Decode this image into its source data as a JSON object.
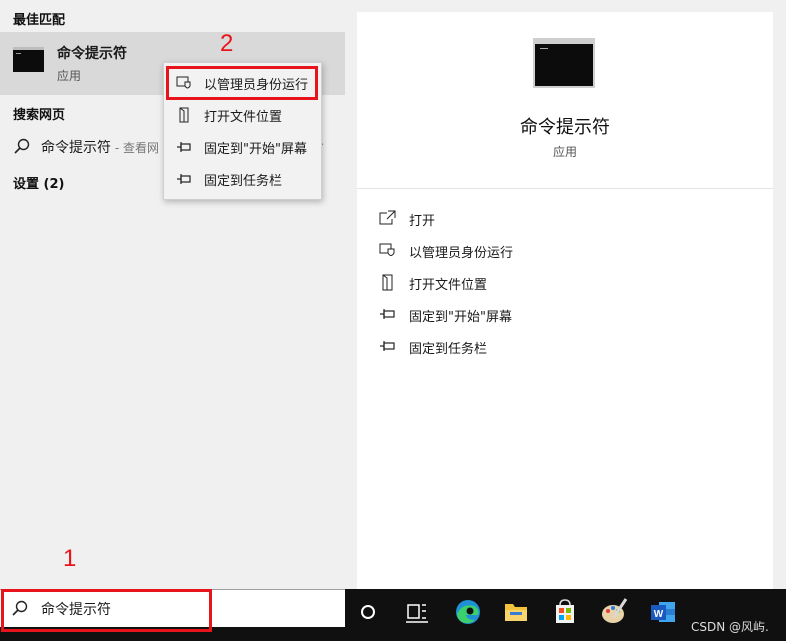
{
  "left_pane": {
    "best_match_header": "最佳匹配",
    "best_match": {
      "title": "命令提示符",
      "subtitle": "应用"
    },
    "web_header": "搜索网页",
    "web_result": {
      "text": "命令提示符",
      "hint": " - 查看网"
    },
    "settings_header": "设置 (2)"
  },
  "context_menu": {
    "items": [
      {
        "label": "以管理员身份运行",
        "icon": "shield-icon"
      },
      {
        "label": "打开文件位置",
        "icon": "file-location-icon"
      },
      {
        "label": "固定到\"开始\"屏幕",
        "icon": "pin-icon"
      },
      {
        "label": "固定到任务栏",
        "icon": "pin-icon"
      }
    ]
  },
  "preview": {
    "title": "命令提示符",
    "subtitle": "应用",
    "actions": [
      {
        "label": "打开",
        "icon": "open-icon"
      },
      {
        "label": "以管理员身份运行",
        "icon": "shield-icon"
      },
      {
        "label": "打开文件位置",
        "icon": "file-location-icon"
      },
      {
        "label": "固定到\"开始\"屏幕",
        "icon": "pin-icon"
      },
      {
        "label": "固定到任务栏",
        "icon": "pin-icon"
      }
    ]
  },
  "search_box": {
    "value": "命令提示符"
  },
  "annotations": {
    "one": "1",
    "two": "2",
    "color": "#e8141b"
  },
  "taskbar": {
    "apps": [
      "cortana-icon",
      "task-view-icon",
      "edge-icon",
      "file-explorer-icon",
      "store-icon",
      "paint-icon",
      "word-icon"
    ]
  },
  "watermark": "CSDN @风屿."
}
